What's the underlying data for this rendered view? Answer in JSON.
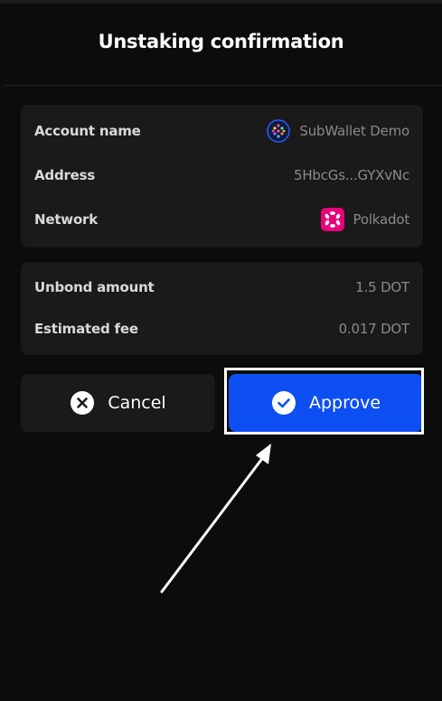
{
  "header": {
    "title": "Unstaking confirmation"
  },
  "account_card": {
    "rows": [
      {
        "label": "Account name",
        "value": "SubWallet Demo",
        "icon": "subwallet-avatar-icon"
      },
      {
        "label": "Address",
        "value": "5HbcGs...GYXvNc"
      },
      {
        "label": "Network",
        "value": "Polkadot",
        "icon": "polkadot-icon"
      }
    ]
  },
  "amount_card": {
    "rows": [
      {
        "label": "Unbond amount",
        "value": "1.5 DOT"
      },
      {
        "label": "Estimated fee",
        "value": "0.017 DOT"
      }
    ]
  },
  "actions": {
    "cancel_label": "Cancel",
    "approve_label": "Approve"
  },
  "colors": {
    "background": "#0c0c0c",
    "card": "#1a1a1a",
    "accent": "#0d4ff2",
    "polkadot": "#e6007a"
  }
}
